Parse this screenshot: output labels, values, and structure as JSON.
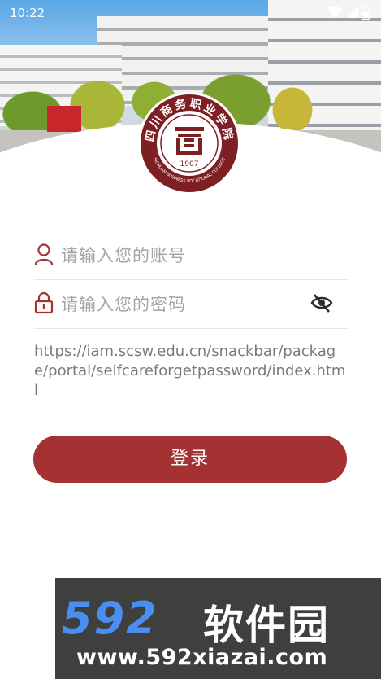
{
  "status_bar": {
    "time": "10:22"
  },
  "logo": {
    "name_cn": "四川商务职业学院",
    "name_en": "SICHUAN BUSINESS VOCATIONAL COLLEGE",
    "year": "1907"
  },
  "form": {
    "account_placeholder": "请输入您的账号",
    "password_placeholder": "请输入您的密码",
    "url_text": "https://iam.scsw.edu.cn/snackbar/package/portal/selfcareforgetpassword/index.html",
    "login_label": "登录"
  },
  "watermark": {
    "number": "592",
    "cn": "软件园",
    "site": "www.592xiazai.com"
  },
  "colors": {
    "accent": "#a53232",
    "placeholder": "#a4a4a4"
  }
}
